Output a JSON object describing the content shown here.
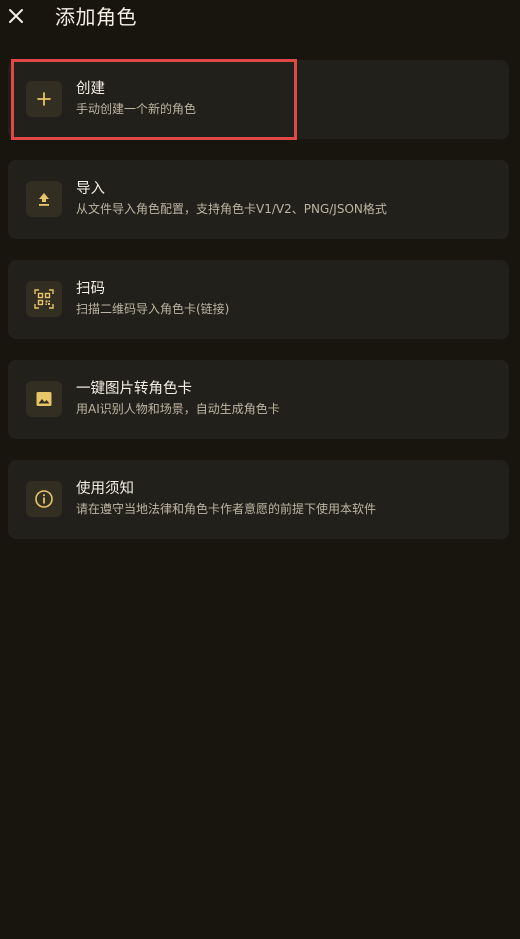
{
  "header": {
    "title": "添加角色",
    "close_icon": "close-icon"
  },
  "accent_color": "#e8c46a",
  "options": [
    {
      "icon": "plus-icon",
      "title": "创建",
      "subtitle": "手动创建一个新的角色"
    },
    {
      "icon": "upload-icon",
      "title": "导入",
      "subtitle": "从文件导入角色配置，支持角色卡V1/V2、PNG/JSON格式"
    },
    {
      "icon": "qr-scan-icon",
      "title": "扫码",
      "subtitle": "扫描二维码导入角色卡(链接)"
    },
    {
      "icon": "image-icon",
      "title": "一键图片转角色卡",
      "subtitle": "用AI识别人物和场景，自动生成角色卡"
    },
    {
      "icon": "info-icon",
      "title": "使用须知",
      "subtitle": "请在遵守当地法律和角色卡作者意愿的前提下使用本软件"
    }
  ]
}
